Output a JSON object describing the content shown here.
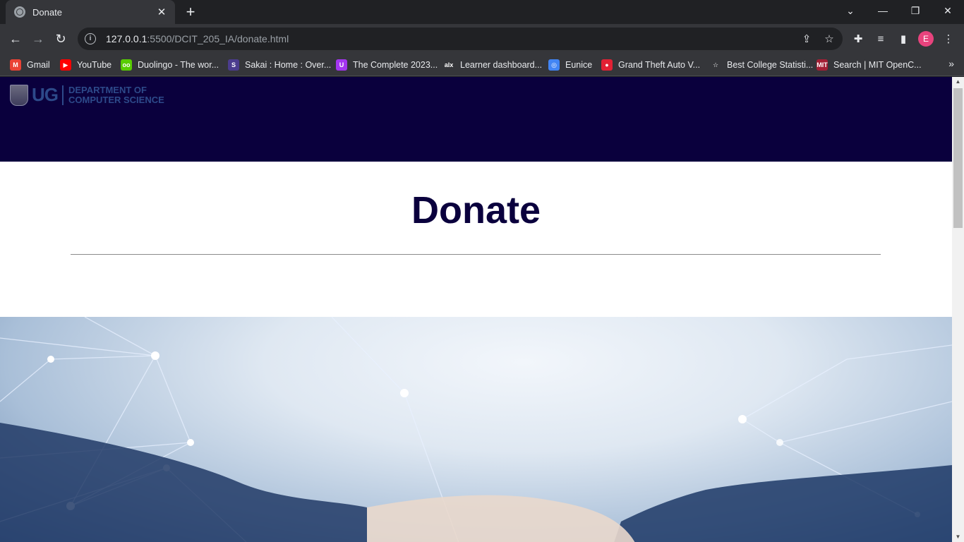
{
  "browser": {
    "tab": {
      "title": "Donate",
      "close_glyph": "✕"
    },
    "new_tab_glyph": "+",
    "window_controls": {
      "dropdown": "⌄",
      "minimize": "—",
      "restore": "❐",
      "close": "✕"
    },
    "nav": {
      "back": "←",
      "forward": "→",
      "reload": "↻"
    },
    "address": {
      "host": "127.0.0.1",
      "rest": ":5500/DCIT_205_IA/donate.html",
      "info_glyph": "i"
    },
    "omnibox_icons": {
      "share": "⇪",
      "bookmark": "☆"
    },
    "extensions": {
      "puzzle": "✚",
      "media": "≡",
      "sidepanel": "▮"
    },
    "profile_initial": "E",
    "bookmarks": [
      {
        "label": "Gmail",
        "icon": "M",
        "color": "#ea4335"
      },
      {
        "label": "YouTube",
        "icon": "▶",
        "color": "#ff0000"
      },
      {
        "label": "Duolingo - The wor...",
        "icon": "oo",
        "color": "#58cc02"
      },
      {
        "label": "Sakai : Home : Over...",
        "icon": "S",
        "color": "#4b3c8e"
      },
      {
        "label": "The Complete 2023...",
        "icon": "U",
        "color": "#a435f0"
      },
      {
        "label": "Learner dashboard...",
        "icon": "alx",
        "color": "#35363a"
      },
      {
        "label": "Eunice",
        "icon": "◎",
        "color": "#4285f4"
      },
      {
        "label": "Grand Theft Auto V...",
        "icon": "●",
        "color": "#e22134"
      },
      {
        "label": "Best College Statisti...",
        "icon": "☆",
        "color": "#35363a"
      },
      {
        "label": "Search | MIT OpenC...",
        "icon": "MIT",
        "color": "#a31f34"
      }
    ],
    "bookmarks_more": "»"
  },
  "site": {
    "logo": {
      "short": "UG",
      "dept_line1": "DEPARTMENT OF",
      "dept_line2": "COMPUTER SCIENCE"
    },
    "page_title": "Donate"
  },
  "colors": {
    "header_bg": "#0a003d",
    "title": "#0a003d",
    "divider": "#8c8c8c"
  }
}
